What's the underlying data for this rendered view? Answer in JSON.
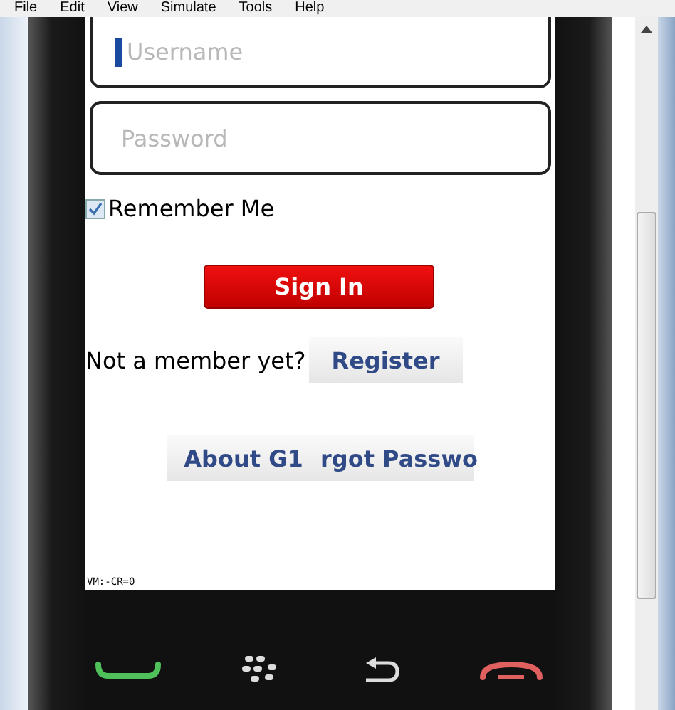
{
  "menu_bar": [
    "File",
    "Edit",
    "View",
    "Simulate",
    "Tools",
    "Help"
  ],
  "fields": [
    {
      "placeholder": "Username",
      "focused": true
    },
    {
      "placeholder": "Password",
      "focused": false
    }
  ],
  "remember": {
    "label": "Remember Me",
    "checked": true
  },
  "sign_in": "Sign In",
  "register_row": {
    "prompt": "Not a member yet?",
    "button": "Register"
  },
  "bottom_buttons": [
    "About G1",
    "rgot Passwo"
  ],
  "status_text": "VM:-CR=0"
}
